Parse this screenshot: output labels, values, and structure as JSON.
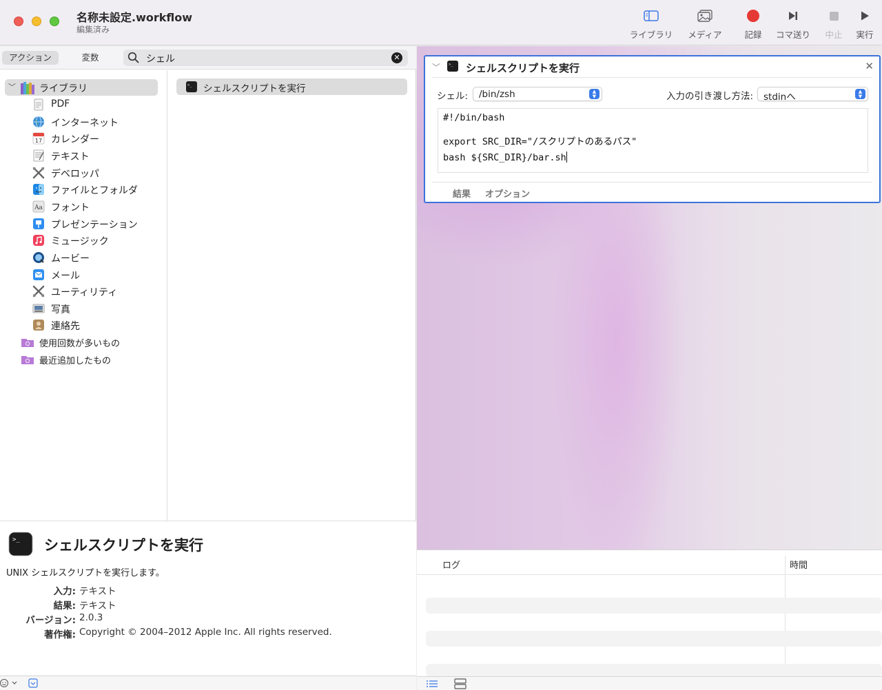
{
  "window": {
    "title": "名称未設定.workflow",
    "subtitle": "編集済み"
  },
  "toolbar": {
    "library": "ライブラリ",
    "media": "メディア",
    "record": "記録",
    "step": "コマ送り",
    "stop": "中止",
    "run": "実行"
  },
  "filter": {
    "tab_actions": "アクション",
    "tab_variables": "変数",
    "search_value": "シェル"
  },
  "library": {
    "root": "ライブラリ",
    "items": [
      {
        "label": "PDF",
        "icon": "pdf-icon"
      },
      {
        "label": "インターネット",
        "icon": "globe-icon"
      },
      {
        "label": "カレンダー",
        "icon": "calendar-icon"
      },
      {
        "label": "テキスト",
        "icon": "text-icon"
      },
      {
        "label": "デベロッパ",
        "icon": "developer-icon"
      },
      {
        "label": "ファイルとフォルダ",
        "icon": "finder-icon"
      },
      {
        "label": "フォント",
        "icon": "font-icon"
      },
      {
        "label": "プレゼンテーション",
        "icon": "keynote-icon"
      },
      {
        "label": "ミュージック",
        "icon": "music-icon"
      },
      {
        "label": "ムービー",
        "icon": "movie-icon"
      },
      {
        "label": "メール",
        "icon": "mail-icon"
      },
      {
        "label": "ユーティリティ",
        "icon": "utility-icon"
      },
      {
        "label": "写真",
        "icon": "photo-icon"
      },
      {
        "label": "連絡先",
        "icon": "contacts-icon"
      }
    ],
    "smart_folders": [
      {
        "label": "使用回数が多いもの",
        "icon": "smart-folder-icon"
      },
      {
        "label": "最近追加したもの",
        "icon": "smart-folder-icon"
      }
    ]
  },
  "actions": {
    "results": [
      "シェルスクリプトを実行"
    ]
  },
  "description": {
    "title": "シェルスクリプトを実行",
    "text": "UNIX シェルスクリプトを実行します。",
    "input_label": "入力:",
    "input_value": "テキスト",
    "result_label": "結果:",
    "result_value": "テキスト",
    "version_label": "バージョン:",
    "version_value": "2.0.3",
    "copyright_label": "著作権:",
    "copyright_value": "Copyright © 2004–2012 Apple Inc.  All rights reserved."
  },
  "card": {
    "title": "シェルスクリプトを実行",
    "shell_label": "シェル:",
    "shell_value": "/bin/zsh",
    "pass_label": "入力の引き渡し方法:",
    "pass_value": "stdinへ",
    "code": {
      "line1": "#!/bin/bash",
      "line2": "export SRC_DIR=\"/スクリプトのあるパス\"",
      "line3": "bash ${SRC_DIR}/bar.sh"
    },
    "tab_results": "結果",
    "tab_options": "オプション"
  },
  "log": {
    "col_log": "ログ",
    "col_time": "時間"
  },
  "colors": {
    "accent": "#3b73d9",
    "record": "#e53935",
    "stepper": "#3a7bea"
  }
}
